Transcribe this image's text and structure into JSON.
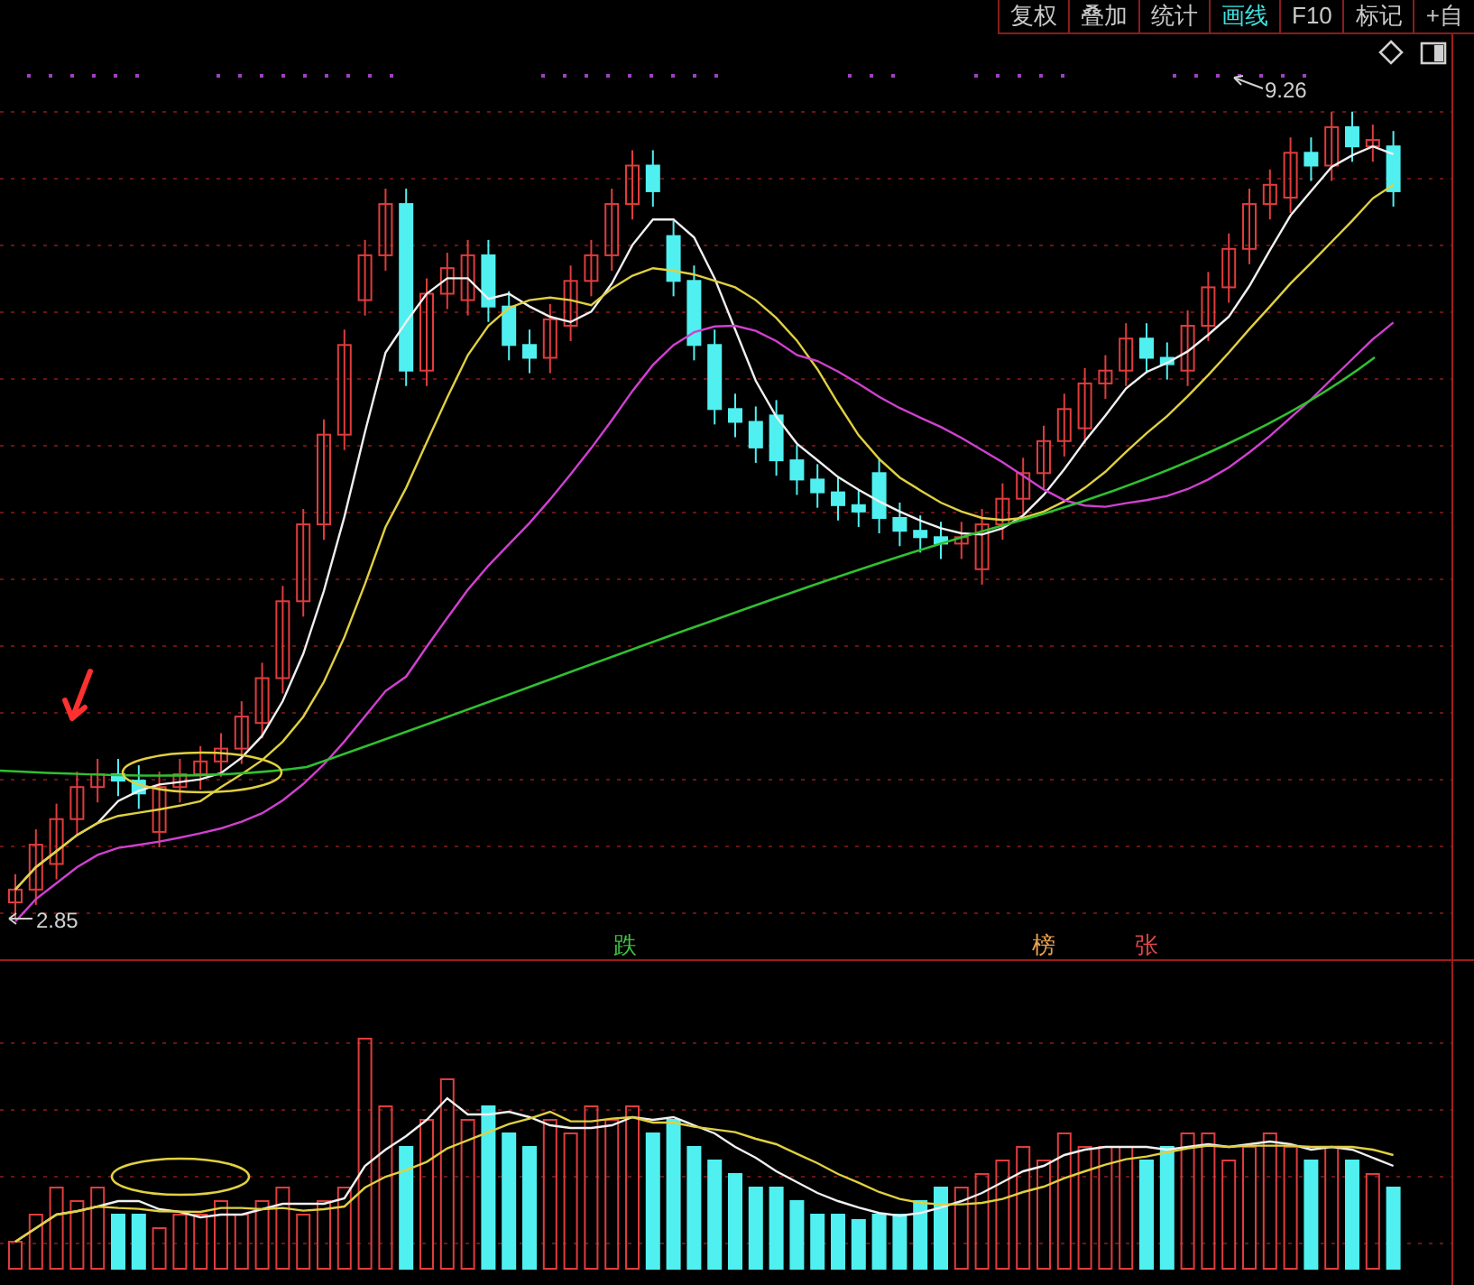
{
  "toolbar": {
    "tabs": [
      {
        "label": "复权",
        "selected": false
      },
      {
        "label": "叠加",
        "selected": false
      },
      {
        "label": "统计",
        "selected": false
      },
      {
        "label": "画线",
        "selected": true
      },
      {
        "label": "F10",
        "selected": false
      },
      {
        "label": "标记",
        "selected": false
      },
      {
        "label": "+自",
        "selected": false
      }
    ]
  },
  "price_chart": {
    "high_label": "9.26",
    "low_label": "2.85",
    "signals": [
      {
        "text": "跌",
        "color": "#3ec43e"
      },
      {
        "text": "榜",
        "color": "#e8a050"
      },
      {
        "text": "张",
        "color": "#e04848"
      }
    ]
  }
}
